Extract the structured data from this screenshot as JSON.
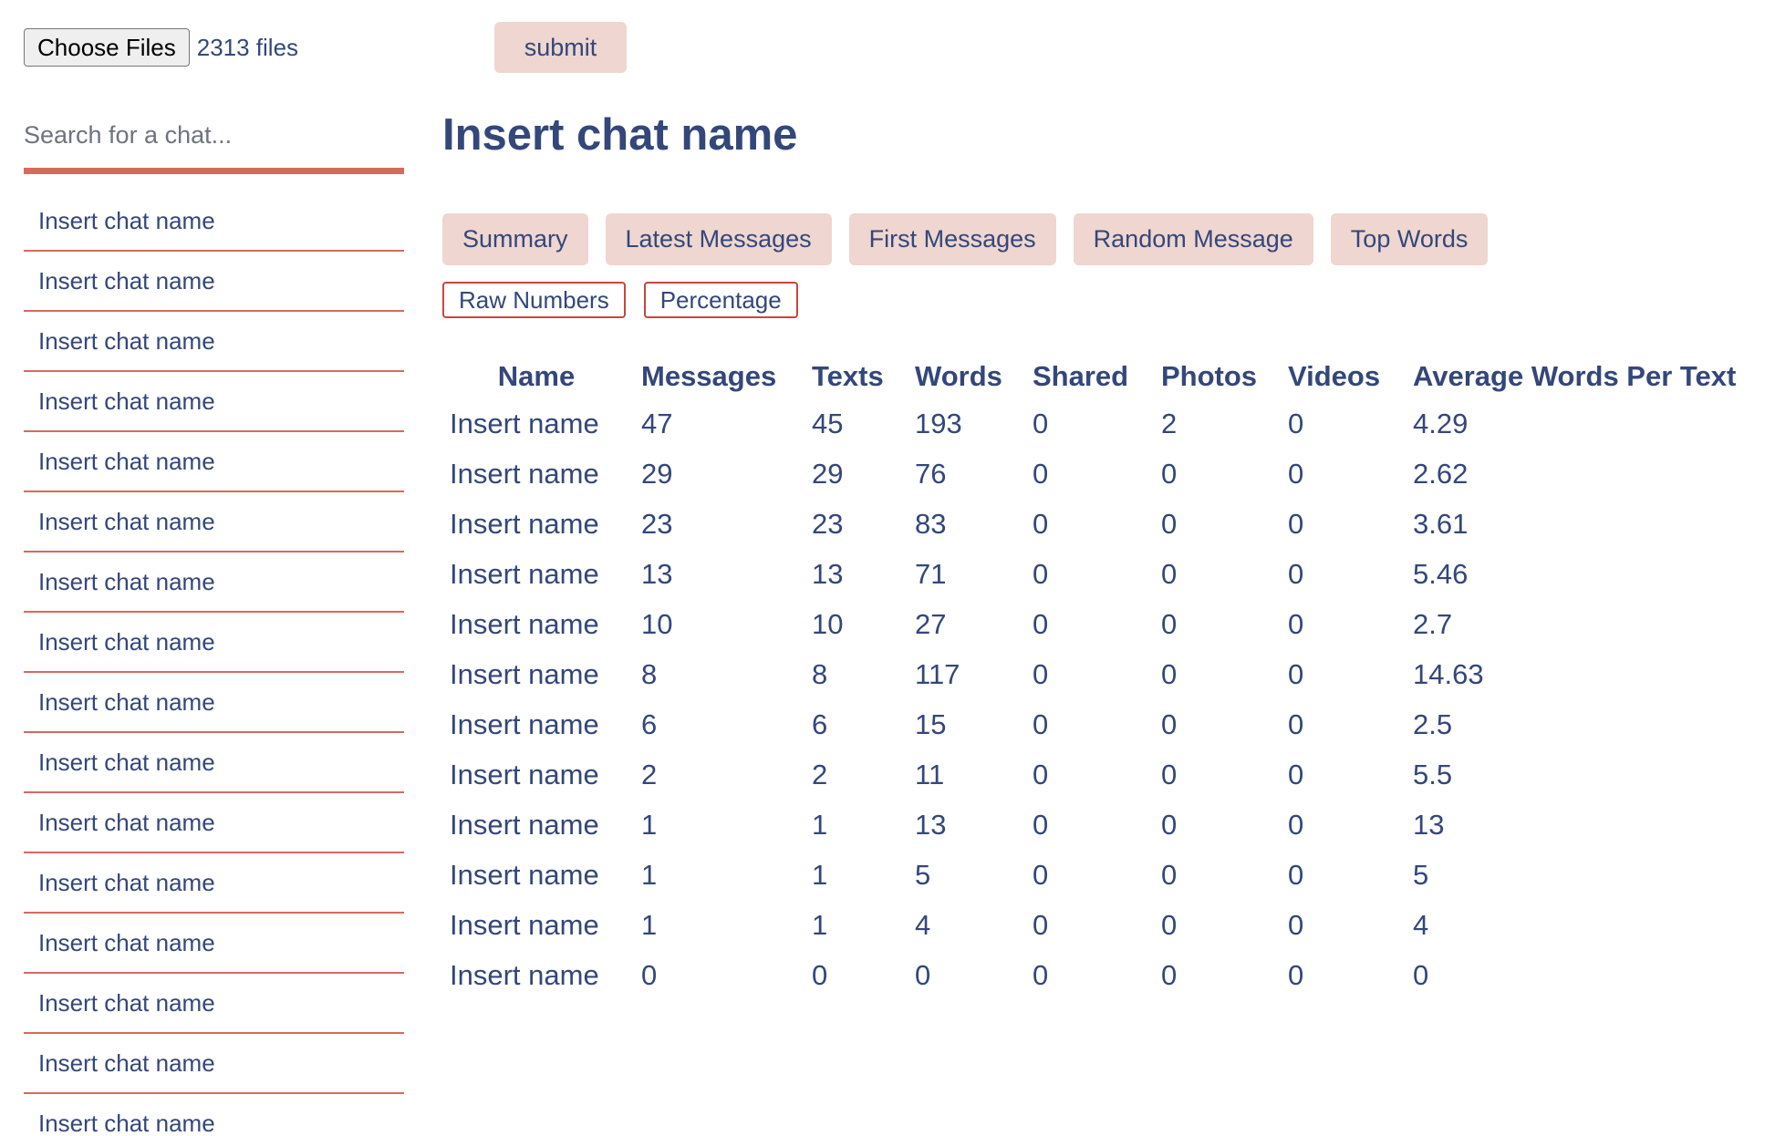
{
  "upload": {
    "choose_files_label": "Choose Files",
    "file_count": "2313 files",
    "submit_label": "submit"
  },
  "sidebar": {
    "search_placeholder": "Search for a chat...",
    "search_value": "",
    "items": [
      {
        "label": "Insert chat name"
      },
      {
        "label": "Insert chat name"
      },
      {
        "label": "Insert chat name"
      },
      {
        "label": "Insert chat name"
      },
      {
        "label": "Insert chat name"
      },
      {
        "label": "Insert chat name"
      },
      {
        "label": "Insert chat name"
      },
      {
        "label": "Insert chat name"
      },
      {
        "label": "Insert chat name"
      },
      {
        "label": "Insert chat name"
      },
      {
        "label": "Insert chat name"
      },
      {
        "label": "Insert chat name"
      },
      {
        "label": "Insert chat name"
      },
      {
        "label": "Insert chat name"
      },
      {
        "label": "Insert chat name"
      },
      {
        "label": "Insert chat name"
      }
    ]
  },
  "main": {
    "title": "Insert chat name",
    "tabs": [
      {
        "label": "Summary"
      },
      {
        "label": "Latest Messages"
      },
      {
        "label": "First Messages"
      },
      {
        "label": "Random Message"
      },
      {
        "label": "Top Words"
      }
    ],
    "modes": [
      {
        "label": "Raw Numbers"
      },
      {
        "label": "Percentage"
      }
    ],
    "table": {
      "headers": [
        "Name",
        "Messages",
        "Texts",
        "Words",
        "Shared",
        "Photos",
        "Videos",
        "Average Words Per Text"
      ],
      "rows": [
        [
          "Insert name",
          "47",
          "45",
          "193",
          "0",
          "2",
          "0",
          "4.29"
        ],
        [
          "Insert name",
          "29",
          "29",
          "76",
          "0",
          "0",
          "0",
          "2.62"
        ],
        [
          "Insert name",
          "23",
          "23",
          "83",
          "0",
          "0",
          "0",
          "3.61"
        ],
        [
          "Insert name",
          "13",
          "13",
          "71",
          "0",
          "0",
          "0",
          "5.46"
        ],
        [
          "Insert name",
          "10",
          "10",
          "27",
          "0",
          "0",
          "0",
          "2.7"
        ],
        [
          "Insert name",
          "8",
          "8",
          "117",
          "0",
          "0",
          "0",
          "14.63"
        ],
        [
          "Insert name",
          "6",
          "6",
          "15",
          "0",
          "0",
          "0",
          "2.5"
        ],
        [
          "Insert name",
          "2",
          "2",
          "11",
          "0",
          "0",
          "0",
          "5.5"
        ],
        [
          "Insert name",
          "1",
          "1",
          "13",
          "0",
          "0",
          "0",
          "13"
        ],
        [
          "Insert name",
          "1",
          "1",
          "5",
          "0",
          "0",
          "0",
          "5"
        ],
        [
          "Insert name",
          "1",
          "1",
          "4",
          "0",
          "0",
          "0",
          "4"
        ],
        [
          "Insert name",
          "0",
          "0",
          "0",
          "0",
          "0",
          "0",
          "0"
        ]
      ]
    }
  },
  "colors": {
    "text": "#34477a",
    "button_bg": "#efd6d0",
    "accent_line": "#d66a5f",
    "mode_border": "#c8463e"
  }
}
